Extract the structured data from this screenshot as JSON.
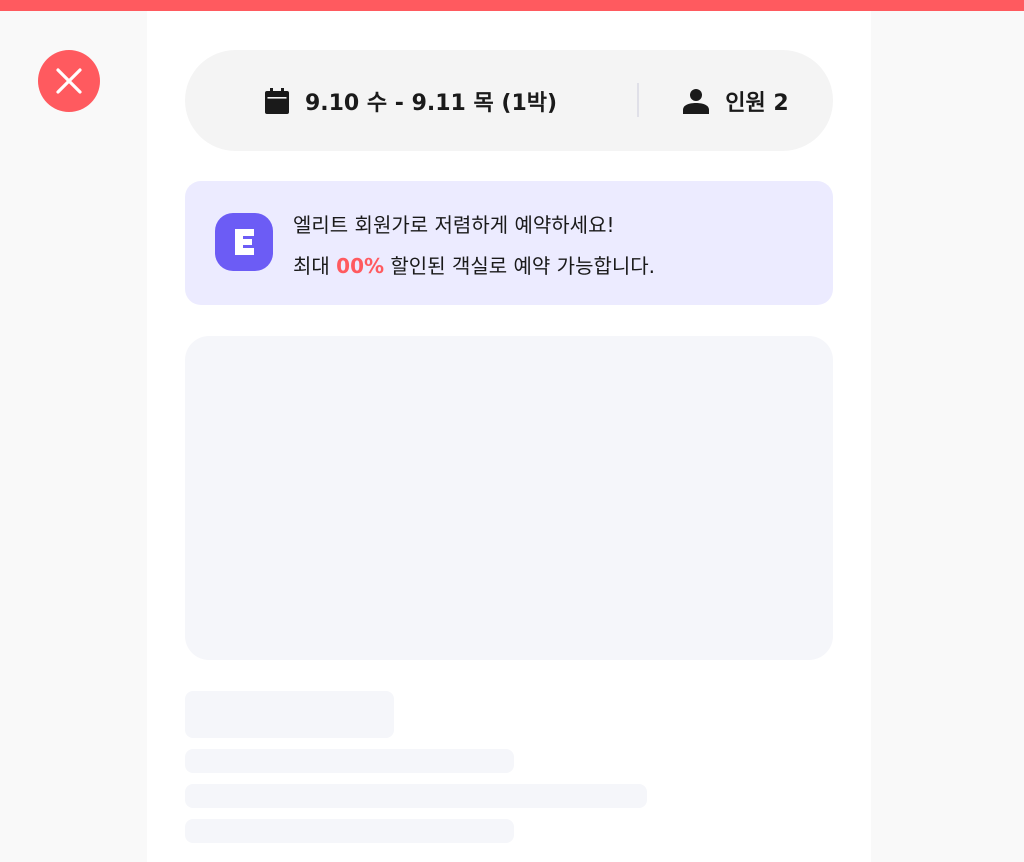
{
  "header": {
    "close_icon": "close-icon",
    "accent_color": "#ff5a5f"
  },
  "search_bar": {
    "date_icon": "calendar-icon",
    "date_text": "9.10 수 - 9.11 목 (1박)",
    "guest_icon": "person-icon",
    "guest_text": "인원 2"
  },
  "promo": {
    "logo_letter": "E",
    "logo_color": "#6c5cf5",
    "line1": "엘리트 회원가로 저렴하게 예약하세요!",
    "line2_prefix": "최대 ",
    "line2_highlight": "00%",
    "line2_suffix": " 할인된 객실로 예약 가능합니다."
  }
}
